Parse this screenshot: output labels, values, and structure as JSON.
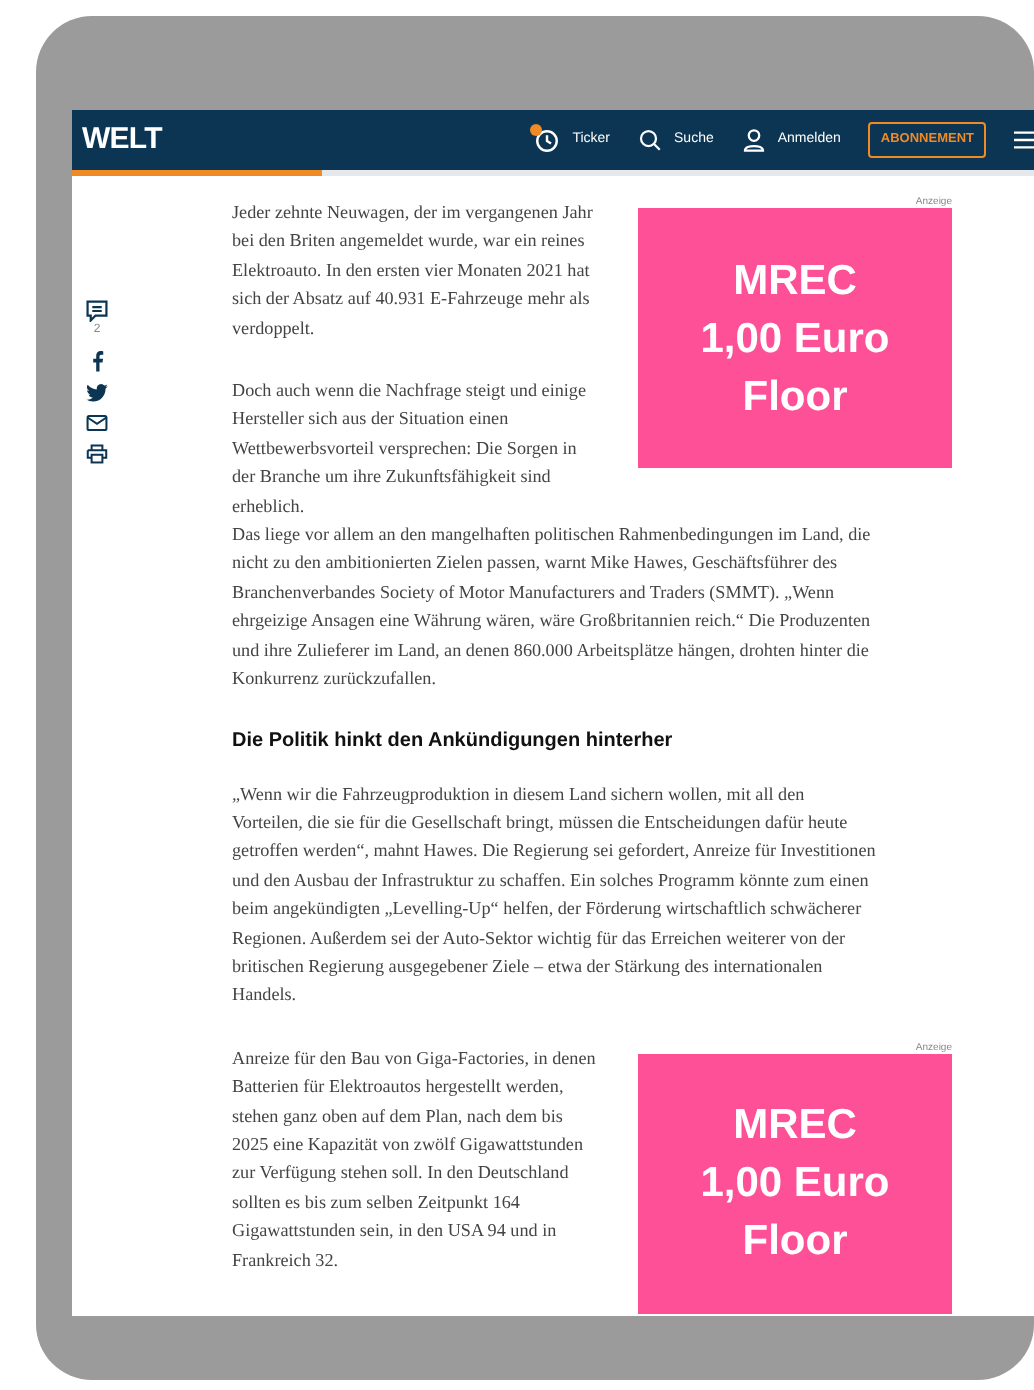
{
  "header": {
    "logo": "WELT",
    "nav": [
      {
        "kind": "ticker",
        "label": "Ticker",
        "badge": true
      },
      {
        "kind": "search",
        "label": "Suche",
        "badge": false
      },
      {
        "kind": "user",
        "label": "Anmelden",
        "badge": false
      }
    ],
    "button": "ABONNEMENT",
    "read_progress": {
      "level": 0.26
    }
  },
  "share_bar": {
    "comment_count": "2",
    "items": [
      {
        "kind": "facebook"
      },
      {
        "kind": "twitter"
      },
      {
        "kind": "mail"
      },
      {
        "kind": "print"
      }
    ]
  },
  "article": [
    {
      "kind": "paragraph",
      "text": "Jeder zehnte Neuwagen, der im vergangenen Jahr bei den Briten angemeldet wurde, war ein reines Elektroauto. In den ersten vier Monaten 2021 hat sich der Absatz auf 40.931 E-Fahrzeuge mehr als verdoppelt."
    },
    {
      "kind": "ad",
      "label": "Anzeige",
      "lines": [
        "MREC",
        "1,00 Euro",
        "Floor"
      ]
    },
    {
      "kind": "paragraph",
      "runs": [
        "Doch auch wenn die Nachfrage steigt und einige Hersteller sich aus der Situation einen Wettbewerbsvorteil versprechen: Die Sorgen in der Branche um ihre Zukunftsfähigkeit sind erheblich.",
        "Das liege vor allem an den mangelhaften politischen Rahmenbedingungen im Land, die nicht zu den ambitionierten Zielen passen, warnt Mike Hawes, Geschäftsführer des Branchenverbandes Society of Motor Manufacturers and Traders (SMMT). „Wenn ehrgeizige Ansagen eine Währung wären, wäre Großbritannien reich.“ Die Produzenten und ihre Zulieferer im Land, an denen 860.000 Arbeitsplätze hängen, drohten hinter die Konkurrenz zurückzufallen."
      ]
    },
    {
      "kind": "heading",
      "text": "Die Politik hinkt den Ankündigungen hinterher"
    },
    {
      "kind": "paragraph",
      "text": "„Wenn wir die Fahrzeugproduktion in diesem Land sichern wollen, mit all den Vorteilen, die sie für die Gesellschaft bringt, müssen die Entscheidungen dafür heute getroffen werden“, mahnt Hawes. Die Regierung sei gefordert, Anreize für Investitionen und den Ausbau der Infrastruktur zu schaffen. Ein solches Programm könnte zum einen beim angekündigten „Levelling-Up“ helfen, der Förderung wirtschaftlich schwächerer Regionen. Außerdem sei der Auto-Sektor wichtig für das Erreichen weiterer von der britischen Regierung ausgegebener Ziele – etwa der Stärkung des internationalen Handels."
    },
    {
      "kind": "paragraph",
      "text": "Anreize für den Bau von Giga-Factories, in denen Batterien für Elektroautos hergestellt werden, stehen ganz oben auf dem Plan, nach dem bis 2025 eine Kapazität von zwölf Gigawattstunden zur Verfügung stehen soll. In den Deutschland sollten es bis zum selben Zeitpunkt 164 Gigawattstunden sein, in den USA 94 und in Frankreich 32."
    },
    {
      "kind": "ad",
      "label": "Anzeige",
      "lines": [
        "MREC",
        "1,00 Euro",
        "Floor"
      ]
    }
  ]
}
